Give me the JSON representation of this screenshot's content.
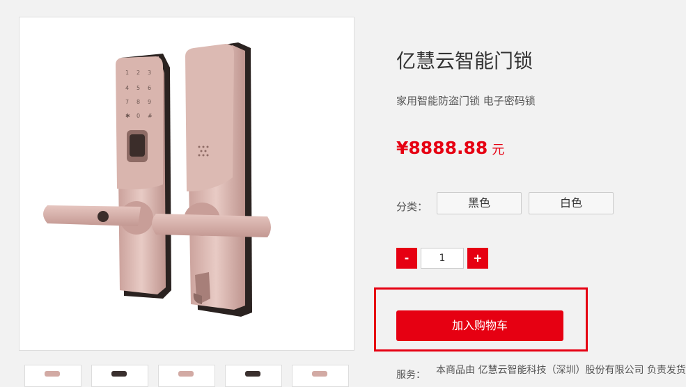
{
  "product": {
    "title": "亿慧云智能门锁",
    "subtitle": "家用智能防盗门锁 电子密码锁",
    "price": "¥8888.88",
    "price_unit": "元"
  },
  "category": {
    "label": "分类：",
    "options": [
      "黑色",
      "白色"
    ]
  },
  "quantity": {
    "minus": "-",
    "value": "1",
    "plus": "+"
  },
  "cart": {
    "button_label": "加入购物车"
  },
  "service": {
    "label": "服务：",
    "text": "本商品由 亿慧云智能科技（深圳）股份有限公司 负责发货"
  },
  "colors": {
    "accent": "#e60012",
    "lock_finish": "#d4aca5",
    "background": "#f2f2f2"
  },
  "images": {
    "main": "smart-door-lock-rose-gold",
    "thumbnail_count": 5
  }
}
